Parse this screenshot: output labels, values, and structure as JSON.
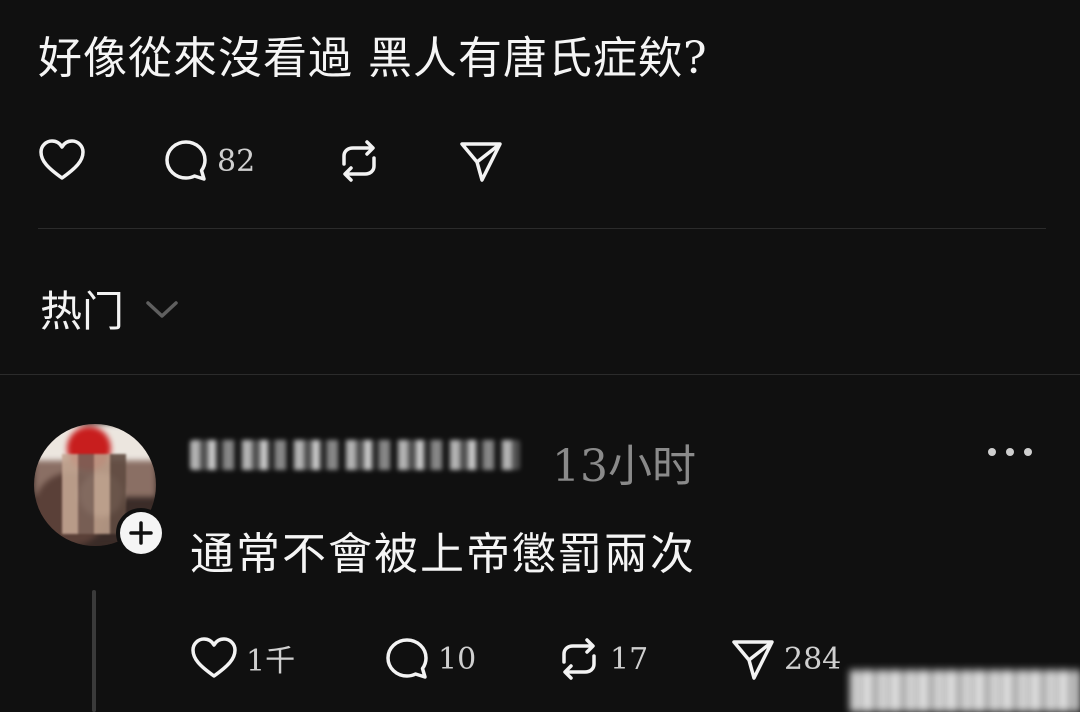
{
  "post": {
    "text": "好像從來沒看過  黑人有唐氏症欸?",
    "actions": {
      "like_count": "",
      "comment_count": "82",
      "repost_count": "",
      "share_count": ""
    }
  },
  "sort": {
    "label": "热门",
    "icon": "chevron-down-icon"
  },
  "reply": {
    "username": "",
    "timestamp": "13小时",
    "text": "通常不會被上帝懲罰兩次",
    "actions": {
      "like_count": "1千",
      "comment_count": "10",
      "repost_count": "17",
      "share_count": "284"
    }
  },
  "colors": {
    "background": "#101010",
    "text": "#f3f3f3",
    "muted": "#8a8a8a",
    "divider": "#2b2b2b"
  }
}
